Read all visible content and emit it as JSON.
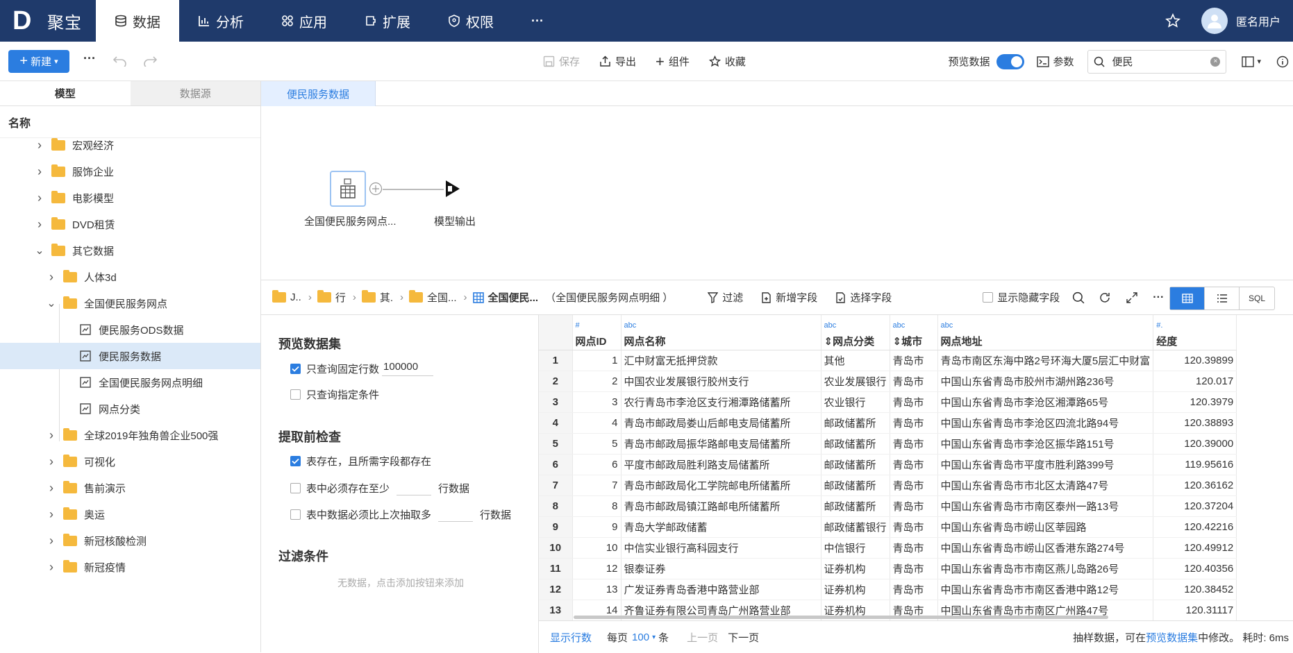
{
  "app": {
    "logo_letter": "D",
    "logo_name": "聚宝"
  },
  "nav": [
    {
      "label": "数据",
      "icon": "database-icon"
    },
    {
      "label": "分析",
      "icon": "bar-chart-icon"
    },
    {
      "label": "应用",
      "icon": "apps-icon"
    },
    {
      "label": "扩展",
      "icon": "extension-icon"
    },
    {
      "label": "权限",
      "icon": "shield-icon"
    },
    {
      "label": "···",
      "icon": "more-icon"
    }
  ],
  "user": {
    "name": "匿名用户"
  },
  "toolbar": {
    "new_label": "新建",
    "save": "保存",
    "export": "导出",
    "component": "组件",
    "favorite": "收藏",
    "preview_label": "预览数据",
    "params": "参数",
    "search_value": "便民"
  },
  "left": {
    "tab_model": "模型",
    "tab_datasource": "数据源",
    "header": "名称",
    "tree": [
      {
        "label": "宏观经济",
        "type": "folder",
        "level": 0,
        "open": false
      },
      {
        "label": "服饰企业",
        "type": "folder",
        "level": 0,
        "open": false
      },
      {
        "label": "电影模型",
        "type": "folder",
        "level": 0,
        "open": false
      },
      {
        "label": "DVD租赁",
        "type": "folder",
        "level": 0,
        "open": false
      },
      {
        "label": "其它数据",
        "type": "folder",
        "level": 0,
        "open": true
      },
      {
        "label": "人体3d",
        "type": "folder",
        "level": 1,
        "open": false
      },
      {
        "label": "全国便民服务网点",
        "type": "folder",
        "level": 1,
        "open": true
      },
      {
        "label": "便民服务ODS数据",
        "type": "dataset",
        "level": 2
      },
      {
        "label": "便民服务数据",
        "type": "dataset",
        "level": 2,
        "selected": true
      },
      {
        "label": "全国便民服务网点明细",
        "type": "dataset",
        "level": 2
      },
      {
        "label": "网点分类",
        "type": "dataset",
        "level": 2
      },
      {
        "label": "全球2019年独角兽企业500强",
        "type": "folder",
        "level": 1,
        "open": false
      },
      {
        "label": "可视化",
        "type": "folder",
        "level": 1,
        "open": false
      },
      {
        "label": "售前演示",
        "type": "folder",
        "level": 1,
        "open": false
      },
      {
        "label": "奥运",
        "type": "folder",
        "level": 1,
        "open": false
      },
      {
        "label": "新冠核酸检测",
        "type": "folder",
        "level": 1,
        "open": false
      },
      {
        "label": "新冠疫情",
        "type": "folder",
        "level": 1,
        "open": false
      }
    ]
  },
  "canvas": {
    "tab": "便民服务数据",
    "node_source": "全国便民服务网点...",
    "node_output": "模型输出"
  },
  "bottom": {
    "crumbs": [
      "J..",
      "行",
      "其.",
      "全国...",
      "全国便民..."
    ],
    "crumb_alias": "（全国便民服务网点明细 ）",
    "filter": "过滤",
    "add_field": "新增字段",
    "select_field": "选择字段",
    "show_hidden": "显示隐藏字段",
    "view_sql": "SQL",
    "config": {
      "sec1": "预览数据集",
      "opt_fixed_rows": "只查询固定行数",
      "fixed_rows_value": "100000",
      "opt_cond": "只查询指定条件",
      "sec2": "提取前检查",
      "opt_exists": "表存在，且所需字段都存在",
      "opt_min_rows": "表中必须存在至少",
      "rows_unit": "行数据",
      "opt_more": "表中数据必须比上次抽取多",
      "sec3": "过滤条件",
      "empty": "无数据，点击添加按钮来添加"
    },
    "columns": [
      {
        "type": "#",
        "name": "网点ID"
      },
      {
        "type": "abc",
        "name": "网点名称"
      },
      {
        "type": "abc",
        "name": "网点分类"
      },
      {
        "type": "abc",
        "name": "城市"
      },
      {
        "type": "abc",
        "name": "网点地址"
      },
      {
        "type": "#.",
        "name": "经度"
      }
    ],
    "rows": [
      [
        "1",
        "1",
        "汇中财富无抵押贷款",
        "其他",
        "青岛市",
        "青岛市南区东海中路2号环海大厦5层汇中财富",
        "120.39899"
      ],
      [
        "2",
        "2",
        "中国农业发展银行胶州支行",
        "农业发展银行",
        "青岛市",
        "中国山东省青岛市胶州市湖州路236号",
        "120.017"
      ],
      [
        "3",
        "3",
        "农行青岛市李沧区支行湘潭路储蓄所",
        "农业银行",
        "青岛市",
        "中国山东省青岛市李沧区湘潭路65号",
        "120.3979"
      ],
      [
        "4",
        "4",
        "青岛市邮政局娄山后邮电支局储蓄所",
        "邮政储蓄所",
        "青岛市",
        "中国山东省青岛市李沧区四流北路94号",
        "120.38893"
      ],
      [
        "5",
        "5",
        "青岛市邮政局振华路邮电支局储蓄所",
        "邮政储蓄所",
        "青岛市",
        "中国山东省青岛市李沧区振华路151号",
        "120.39000"
      ],
      [
        "6",
        "6",
        "平度市邮政局胜利路支局储蓄所",
        "邮政储蓄所",
        "青岛市",
        "中国山东省青岛市平度市胜利路399号",
        "119.95616"
      ],
      [
        "7",
        "7",
        "青岛市邮政局化工学院邮电所储蓄所",
        "邮政储蓄所",
        "青岛市",
        "中国山东省青岛市市北区太清路47号",
        "120.36162"
      ],
      [
        "8",
        "8",
        "青岛市邮政局镇江路邮电所储蓄所",
        "邮政储蓄所",
        "青岛市",
        "中国山东省青岛市市南区泰州一路13号",
        "120.37204"
      ],
      [
        "9",
        "9",
        "青岛大学邮政储蓄",
        "邮政储蓄银行",
        "青岛市",
        "中国山东省青岛市崂山区莘园路",
        "120.42216"
      ],
      [
        "10",
        "10",
        "中信实业银行高科园支行",
        "中信银行",
        "青岛市",
        "中国山东省青岛市崂山区香港东路274号",
        "120.49912"
      ],
      [
        "11",
        "12",
        "银泰证券",
        "证券机构",
        "青岛市",
        "中国山东省青岛市市南区燕儿岛路26号",
        "120.40356"
      ],
      [
        "12",
        "13",
        "广发证券青岛香港中路营业部",
        "证券机构",
        "青岛市",
        "中国山东省青岛市市南区香港中路12号",
        "120.38452"
      ],
      [
        "13",
        "14",
        "齐鲁证券有限公司青岛广州路营业部",
        "证券机构",
        "青岛市",
        "中国山东省青岛市市南区广州路47号",
        "120.31117"
      ]
    ],
    "footer": {
      "show_rows": "显示行数",
      "per_page": "每页",
      "page_size": "100",
      "unit": "条",
      "prev": "上一页",
      "next": "下一页",
      "note_pre": "抽样数据，可在",
      "note_link": "预览数据集",
      "note_post": "中修改。 耗时: 6ms"
    }
  },
  "colors": {
    "primary": "#2b7de0",
    "topbar": "#1f3a6b"
  }
}
